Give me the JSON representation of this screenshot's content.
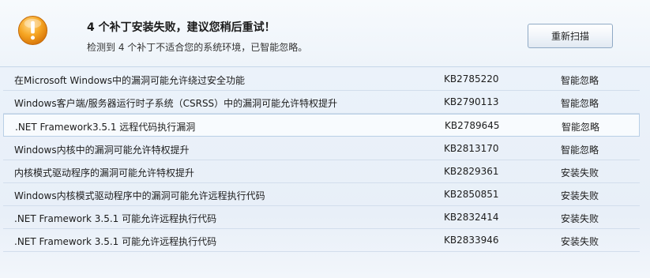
{
  "header": {
    "title": "4 个补丁安装失败，建议您稍后重试！",
    "subtitle": "检测到 4 个补丁不适合您的系统环境，已智能忽略。",
    "rescan_label": "重新扫描",
    "icon": "warning-icon",
    "accent_color": "#f0a020"
  },
  "patches": [
    {
      "name": "在Microsoft Windows中的漏洞可能允许绕过安全功能",
      "kb": "KB2785220",
      "status": "智能忽略"
    },
    {
      "name": "Windows客户端/服务器运行时子系统（CSRSS）中的漏洞可能允许特权提升",
      "kb": "KB2790113",
      "status": "智能忽略"
    },
    {
      "name": ".NET Framework3.5.1 远程代码执行漏洞",
      "kb": "KB2789645",
      "status": "智能忽略"
    },
    {
      "name": "Windows内核中的漏洞可能允许特权提升",
      "kb": "KB2813170",
      "status": "智能忽略"
    },
    {
      "name": "内核模式驱动程序的漏洞可能允许特权提升",
      "kb": "KB2829361",
      "status": "安装失败"
    },
    {
      "name": "Windows内核模式驱动程序中的漏洞可能允许远程执行代码",
      "kb": "KB2850851",
      "status": "安装失败"
    },
    {
      "name": ".NET Framework 3.5.1 可能允许远程执行代码",
      "kb": "KB2832414",
      "status": "安装失败"
    },
    {
      "name": ".NET Framework 3.5.1 可能允许远程执行代码",
      "kb": "KB2833946",
      "status": "安装失败"
    }
  ]
}
